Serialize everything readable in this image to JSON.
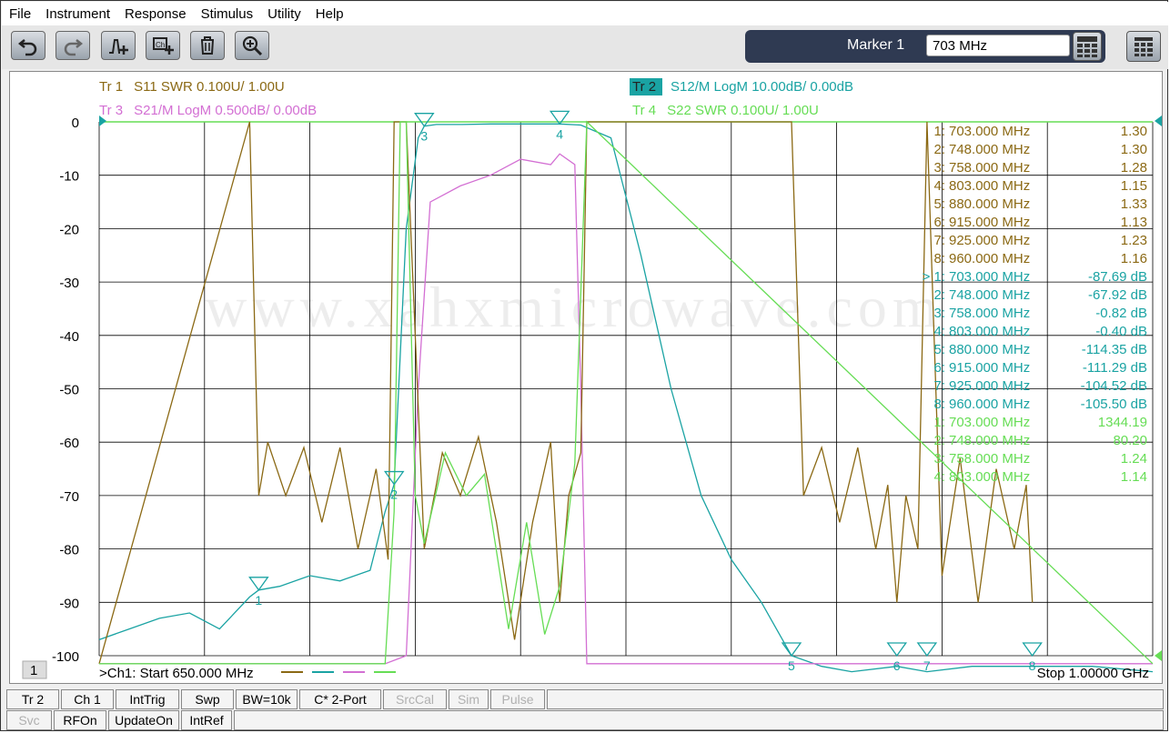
{
  "menu": [
    "File",
    "Instrument",
    "Response",
    "Stimulus",
    "Utility",
    "Help"
  ],
  "toolbar": {
    "buttons": [
      "undo-icon",
      "redo-icon",
      "add-marker-icon",
      "channel-trace-icon",
      "delete-icon",
      "zoom-icon"
    ]
  },
  "marker": {
    "label": "Marker 1",
    "value": "703 MHz"
  },
  "traces": {
    "tr1": {
      "id": "Tr 1",
      "desc": "S11 SWR 0.100U/ 1.00U",
      "color": "#8b6914"
    },
    "tr2": {
      "id": "Tr 2",
      "desc": "S12/M LogM 10.00dB/ 0.00dB",
      "color": "#1aa3a3"
    },
    "tr3": {
      "id": "Tr 3",
      "desc": "S21/M LogM 0.500dB/ 0.00dB",
      "color": "#d36fd3"
    },
    "tr4": {
      "id": "Tr 4",
      "desc": "S22 SWR 0.100U/ 1.00U",
      "color": "#66dd55"
    }
  },
  "watermark": "www.xahxmicrowave.com",
  "y_ticks": [
    "0",
    "-10",
    "-20",
    "-30",
    "-40",
    "-50",
    "-60",
    "-70",
    "-80",
    "-90",
    "-100"
  ],
  "marker_table": [
    {
      "n": "1:",
      "freq": "703.000",
      "unit": "MHz",
      "val": "1.30",
      "color": "#8b6914"
    },
    {
      "n": "2:",
      "freq": "748.000",
      "unit": "MHz",
      "val": "1.30",
      "color": "#8b6914"
    },
    {
      "n": "3:",
      "freq": "758.000",
      "unit": "MHz",
      "val": "1.28",
      "color": "#8b6914"
    },
    {
      "n": "4:",
      "freq": "803.000",
      "unit": "MHz",
      "val": "1.15",
      "color": "#8b6914"
    },
    {
      "n": "5:",
      "freq": "880.000",
      "unit": "MHz",
      "val": "1.33",
      "color": "#8b6914"
    },
    {
      "n": "6:",
      "freq": "915.000",
      "unit": "MHz",
      "val": "1.13",
      "color": "#8b6914"
    },
    {
      "n": "7:",
      "freq": "925.000",
      "unit": "MHz",
      "val": "1.23",
      "color": "#8b6914"
    },
    {
      "n": "8:",
      "freq": "960.000",
      "unit": "MHz",
      "val": "1.16",
      "color": "#8b6914"
    },
    {
      "n": "> 1:",
      "freq": "703.000",
      "unit": "MHz",
      "val": "-87.69 dB",
      "color": "#1aa3a3"
    },
    {
      "n": "2:",
      "freq": "748.000",
      "unit": "MHz",
      "val": "-67.92 dB",
      "color": "#1aa3a3"
    },
    {
      "n": "3:",
      "freq": "758.000",
      "unit": "MHz",
      "val": "-0.82 dB",
      "color": "#1aa3a3"
    },
    {
      "n": "4:",
      "freq": "803.000",
      "unit": "MHz",
      "val": "-0.40 dB",
      "color": "#1aa3a3"
    },
    {
      "n": "5:",
      "freq": "880.000",
      "unit": "MHz",
      "val": "-114.35 dB",
      "color": "#1aa3a3"
    },
    {
      "n": "6:",
      "freq": "915.000",
      "unit": "MHz",
      "val": "-111.29 dB",
      "color": "#1aa3a3"
    },
    {
      "n": "7:",
      "freq": "925.000",
      "unit": "MHz",
      "val": "-104.52 dB",
      "color": "#1aa3a3"
    },
    {
      "n": "8:",
      "freq": "960.000",
      "unit": "MHz",
      "val": "-105.50 dB",
      "color": "#1aa3a3"
    },
    {
      "n": "1:",
      "freq": "703.000",
      "unit": "MHz",
      "val": "1344.19",
      "color": "#66dd55"
    },
    {
      "n": "2:",
      "freq": "748.000",
      "unit": "MHz",
      "val": "80.20",
      "color": "#66dd55"
    },
    {
      "n": "3:",
      "freq": "758.000",
      "unit": "MHz",
      "val": "1.24",
      "color": "#66dd55"
    },
    {
      "n": "4:",
      "freq": "803.000",
      "unit": "MHz",
      "val": "1.14",
      "color": "#66dd55"
    }
  ],
  "status": {
    "channel_num": "1",
    "start": ">Ch1:  Start  650.000 MHz",
    "stop": "Stop  1.00000 GHz"
  },
  "softkeys_row1": [
    "Tr 2",
    "Ch 1",
    "IntTrig",
    "Swp",
    "BW=10k",
    "C* 2-Port",
    "SrcCal",
    "Sim",
    "Pulse"
  ],
  "softkeys_row1_disabled": [
    false,
    false,
    false,
    false,
    false,
    false,
    true,
    true,
    true
  ],
  "softkeys_row2": [
    "Svc",
    "RFOn",
    "UpdateOn",
    "IntRef"
  ],
  "softkeys_row2_disabled": [
    true,
    false,
    false,
    false
  ],
  "chart_data": {
    "type": "line",
    "x_range_mhz": [
      650,
      1000
    ],
    "ylim": [
      -100,
      0
    ],
    "grid": true,
    "markers_mhz": [
      703,
      748,
      758,
      803,
      880,
      915,
      925,
      960
    ],
    "series": [
      {
        "name": "S12/M LogM",
        "color": "#1aa3a3",
        "x": [
          650,
          660,
          670,
          680,
          690,
          700,
          703,
          710,
          720,
          730,
          740,
          745,
          748,
          752,
          756,
          758,
          762,
          770,
          780,
          790,
          800,
          803,
          810,
          820,
          830,
          840,
          850,
          860,
          870,
          880,
          890,
          900,
          915,
          925,
          940,
          960,
          980,
          1000
        ],
        "y": [
          -97,
          -95,
          -93,
          -92,
          -95,
          -89,
          -87.7,
          -87,
          -85,
          -86,
          -84,
          -73,
          -67.9,
          -20,
          -3,
          -0.8,
          -0.5,
          -0.5,
          -0.4,
          -0.4,
          -0.4,
          -0.4,
          -0.6,
          -3,
          -25,
          -50,
          -70,
          -82,
          -90,
          -100,
          -102,
          -103,
          -102,
          -103,
          -102,
          -102,
          -102,
          -103
        ]
      },
      {
        "name": "S21/M LogM",
        "color": "#d36fd3",
        "x": [
          650,
          745,
          752,
          756,
          760,
          770,
          780,
          790,
          800,
          803,
          808,
          810,
          812,
          1000
        ],
        "y": [
          -101.5,
          -101.5,
          -100,
          -50,
          -15,
          -12,
          -10,
          -7,
          -8,
          -6,
          -8,
          -50,
          -101.5,
          -101.5
        ]
      },
      {
        "name": "S11 SWR",
        "color": "#8b6914",
        "x": [
          650,
          700,
          703,
          706,
          712,
          718,
          724,
          730,
          736,
          742,
          746,
          748,
          752,
          758,
          764,
          770,
          776,
          782,
          788,
          794,
          800,
          803,
          806,
          810,
          812,
          880,
          884,
          890,
          896,
          902,
          908,
          912,
          915,
          918,
          922,
          925,
          930,
          936,
          942,
          948,
          954,
          958,
          960
        ],
        "y": [
          -101.5,
          0,
          -70,
          -60,
          -70,
          -61,
          -75,
          -61,
          -80,
          -65,
          -82,
          0,
          0,
          -80,
          -62,
          -70,
          -59,
          -75,
          -97,
          -75,
          -60,
          -90,
          -70,
          -62,
          0,
          0,
          -70,
          -61,
          -75,
          -61,
          -80,
          -68,
          -90,
          -70,
          -80,
          0,
          -85,
          -63,
          -90,
          -65,
          -80,
          -68,
          -90
        ]
      },
      {
        "name": "S22 SWR",
        "color": "#66dd55",
        "x": [
          650,
          745,
          748,
          750,
          752,
          755,
          758,
          765,
          772,
          778,
          786,
          792,
          798,
          803,
          808,
          812,
          1000
        ],
        "y": [
          -101.5,
          -101.5,
          -73,
          0,
          0,
          -70,
          -79,
          -62,
          -70,
          -66,
          -95,
          -75,
          -96,
          -87,
          -64,
          0,
          -101.5
        ]
      }
    ]
  }
}
